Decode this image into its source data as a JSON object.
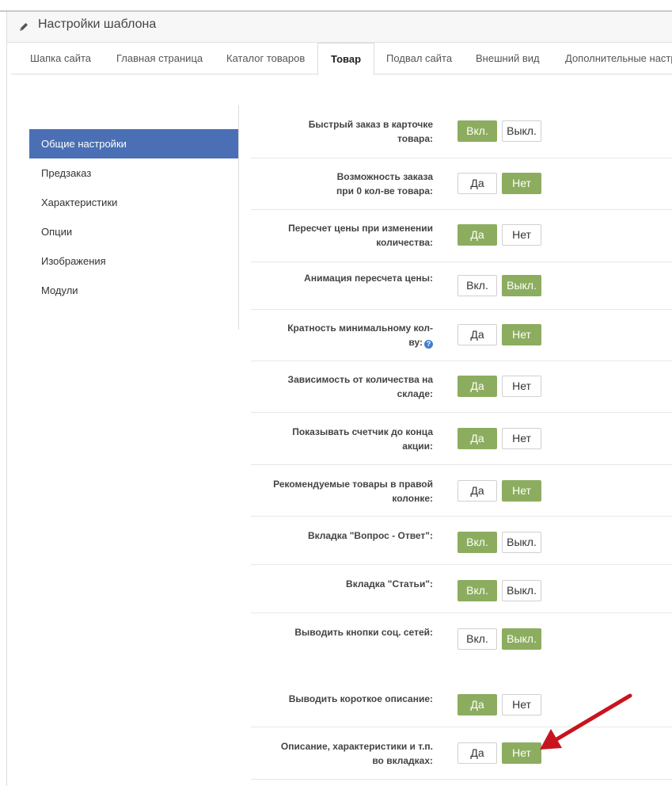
{
  "header": {
    "title": "Настройки шаблона",
    "icon": "pencil-icon"
  },
  "tabs": [
    {
      "label": "Шапка сайта",
      "active": false
    },
    {
      "label": "Главная страница",
      "active": false
    },
    {
      "label": "Каталог товаров",
      "active": false
    },
    {
      "label": "Товар",
      "active": true
    },
    {
      "label": "Подвал сайта",
      "active": false
    },
    {
      "label": "Внешний вид",
      "active": false
    },
    {
      "label": "Дополнительные настр",
      "active": false
    }
  ],
  "sidebar": {
    "items": [
      {
        "label": "Общие настройки",
        "active": true
      },
      {
        "label": "Предзаказ",
        "active": false
      },
      {
        "label": "Характеристики",
        "active": false
      },
      {
        "label": "Опции",
        "active": false
      },
      {
        "label": "Изображения",
        "active": false
      },
      {
        "label": "Модули",
        "active": false
      }
    ]
  },
  "settings": [
    {
      "line1": "Быстрый заказ в карточке",
      "line2": "товара:",
      "opt1": "Вкл.",
      "opt2": "Выкл.",
      "selected": 1
    },
    {
      "line1": "Возможность заказа",
      "line2": "при 0 кол-ве товара:",
      "opt1": "Да",
      "opt2": "Нет",
      "selected": 2
    },
    {
      "line1": "Пересчет цены при изменении",
      "line2": "количества:",
      "opt1": "Да",
      "opt2": "Нет",
      "selected": 1
    },
    {
      "line1": "Анимация пересчета цены:",
      "line2": "",
      "opt1": "Вкл.",
      "opt2": "Выкл.",
      "selected": 2
    },
    {
      "line1": "Кратность минимальному кол-",
      "line2": "ву:",
      "opt1": "Да",
      "opt2": "Нет",
      "selected": 2,
      "help": true
    },
    {
      "line1": "Зависимость от количества на",
      "line2": "складе:",
      "opt1": "Да",
      "opt2": "Нет",
      "selected": 1
    },
    {
      "line1": "Показывать счетчик до конца",
      "line2": "акции:",
      "opt1": "Да",
      "opt2": "Нет",
      "selected": 1
    },
    {
      "line1": "Рекомендуемые товары в правой",
      "line2": "колонке:",
      "opt1": "Да",
      "opt2": "Нет",
      "selected": 2
    },
    {
      "line1": "Вкладка \"Вопрос - Ответ\":",
      "line2": "",
      "opt1": "Вкл.",
      "opt2": "Выкл.",
      "selected": 1
    },
    {
      "line1": "Вкладка \"Статьи\":",
      "line2": "",
      "opt1": "Вкл.",
      "opt2": "Выкл.",
      "selected": 1
    },
    {
      "line1": "Выводить кнопки соц. сетей:",
      "line2": "",
      "opt1": "Вкл.",
      "opt2": "Выкл.",
      "selected": 2
    },
    {
      "line1": "Выводить короткое описание:",
      "line2": "",
      "opt1": "Да",
      "opt2": "Нет",
      "selected": 1
    },
    {
      "line1": "Описание, характеристики и т.п.",
      "line2": "во вкладках:",
      "opt1": "Да",
      "opt2": "Нет",
      "selected": 2
    }
  ],
  "colors": {
    "accent_blue": "#4a6fb5",
    "toggle_on": "#8cad5f",
    "annotation_arrow": "#c8141e"
  }
}
